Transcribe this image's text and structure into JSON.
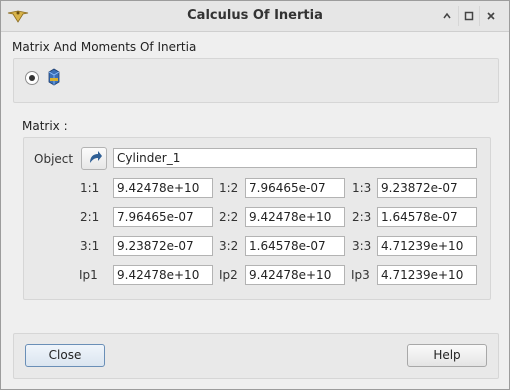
{
  "window": {
    "title": "Calculus Of Inertia"
  },
  "section1": {
    "label": "Matrix And Moments Of Inertia"
  },
  "section2": {
    "label": "Matrix :"
  },
  "object": {
    "label": "Object",
    "value": "Cylinder_1"
  },
  "matrix": [
    {
      "cells": [
        {
          "label": "1:1",
          "value": "9.42478e+10"
        },
        {
          "label": "1:2",
          "value": "7.96465e-07"
        },
        {
          "label": "1:3",
          "value": "9.23872e-07"
        }
      ]
    },
    {
      "cells": [
        {
          "label": "2:1",
          "value": "7.96465e-07"
        },
        {
          "label": "2:2",
          "value": "9.42478e+10"
        },
        {
          "label": "2:3",
          "value": "1.64578e-07"
        }
      ]
    },
    {
      "cells": [
        {
          "label": "3:1",
          "value": "9.23872e-07"
        },
        {
          "label": "3:2",
          "value": "1.64578e-07"
        },
        {
          "label": "3:3",
          "value": "4.71239e+10"
        }
      ]
    },
    {
      "cells": [
        {
          "label": "Ip1",
          "value": "9.42478e+10"
        },
        {
          "label": "Ip2",
          "value": "9.42478e+10"
        },
        {
          "label": "Ip3",
          "value": "4.71239e+10"
        }
      ]
    }
  ],
  "buttons": {
    "close": "Close",
    "help": "Help"
  },
  "icons": {
    "app": "compass-icon",
    "solid": "solid-icon",
    "select": "select-arrow-icon",
    "window_controls": [
      "up-icon",
      "maximize-icon",
      "close-icon"
    ]
  }
}
